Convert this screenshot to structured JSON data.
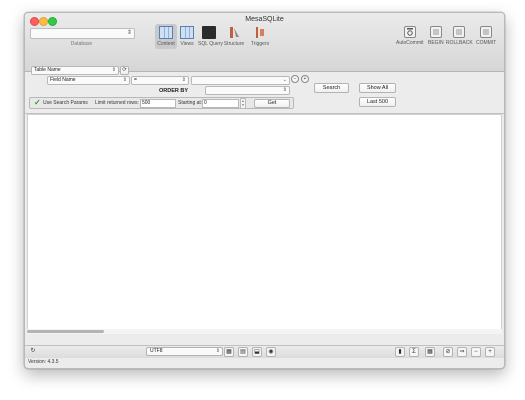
{
  "window": {
    "title": "MesaSQLite"
  },
  "toolbar": {
    "database_label": "Database",
    "tools": [
      {
        "label": "Content",
        "active": true
      },
      {
        "label": "Views"
      },
      {
        "label": "SQL Query"
      },
      {
        "label": "Structure"
      },
      {
        "label": "Triggers"
      }
    ],
    "right_tools": [
      {
        "label": "AutoCommit"
      },
      {
        "label": "BEGIN"
      },
      {
        "label": "ROLLBACK"
      },
      {
        "label": "COMMIT"
      }
    ]
  },
  "search": {
    "table_select": "Table Name",
    "field_select": "Field Name",
    "operator_select": "=",
    "value_select": "",
    "order_by_label": "ORDER BY",
    "order_by_select": "",
    "search_button": "Search",
    "show_all_button": "Show All",
    "last_500_button": "Last 500",
    "use_params_label": "Use Search Params",
    "use_params_checked": true,
    "limit_label": "Limit returned rows:",
    "limit_value": "500",
    "starting_label": "Starting at:",
    "starting_value": "0",
    "get_button": "Get"
  },
  "bottom": {
    "encoding": "UTF8",
    "version": "Version: 4.3.5"
  },
  "colors": {
    "accent": "#5a7fb5",
    "check": "#2a9d2a"
  }
}
